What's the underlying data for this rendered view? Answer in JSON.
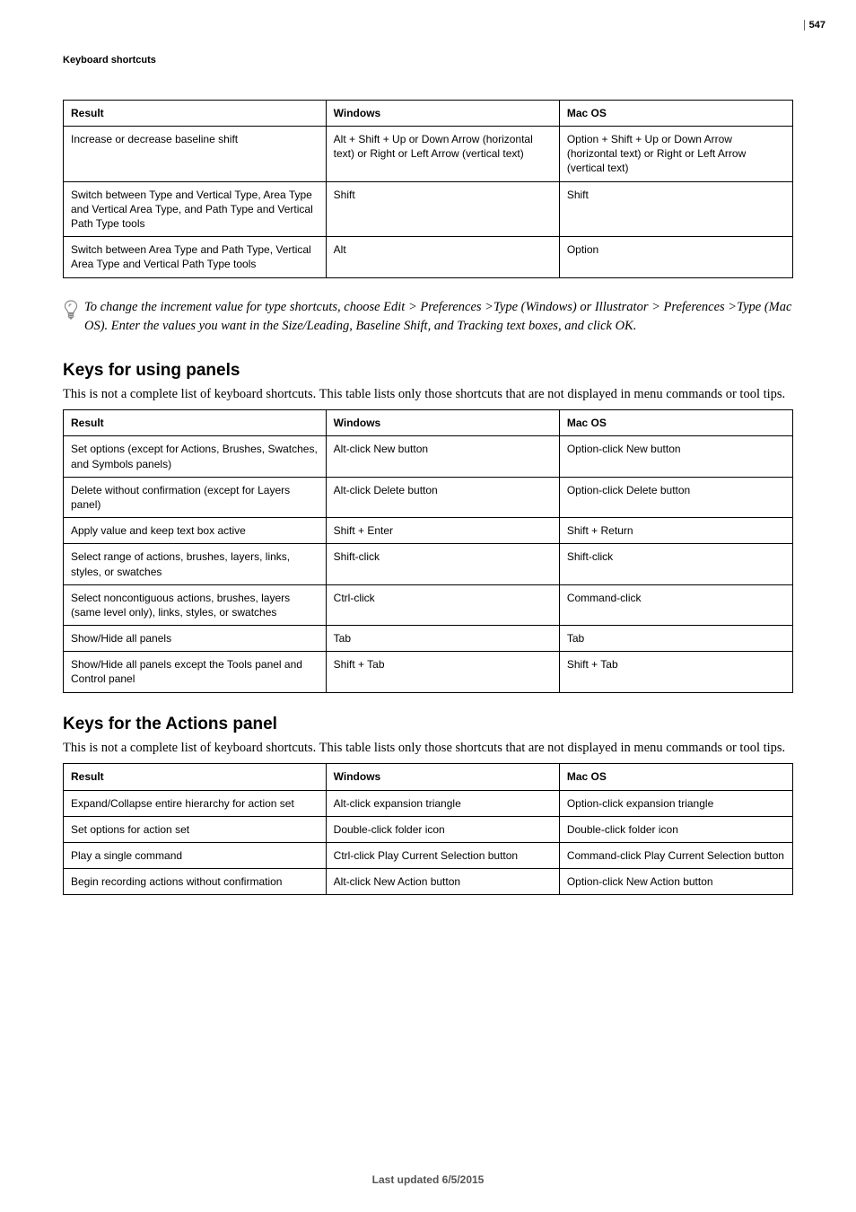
{
  "page_number": "547",
  "running_head": "Keyboard shortcuts",
  "footer": "Last updated 6/5/2015",
  "table_type_cont": {
    "headers": [
      "Result",
      "Windows",
      "Mac OS"
    ],
    "rows": [
      [
        "Increase or decrease baseline shift",
        "Alt + Shift + Up or Down Arrow (horizontal text) or Right or Left Arrow (vertical text)",
        "Option + Shift + Up or Down Arrow (horizontal text) or Right or Left Arrow (vertical text)"
      ],
      [
        "Switch between Type and Vertical Type, Area Type and Vertical Area Type, and Path Type and Vertical Path Type tools",
        "Shift",
        "Shift"
      ],
      [
        "Switch between Area Type and Path Type, Vertical Area Type and Vertical Path Type tools",
        "Alt",
        "Option"
      ]
    ]
  },
  "tip_text": "To change the increment value for type shortcuts, choose Edit > Preferences >Type (Windows) or Illustrator > Preferences >Type (Mac OS). Enter the values you want in the Size/Leading, Baseline Shift, and Tracking text boxes, and click OK.",
  "section_panels": {
    "heading": "Keys for using panels",
    "intro": "This is not a complete list of keyboard shortcuts. This table lists only those shortcuts that are not displayed in menu commands or tool tips.",
    "table": {
      "headers": [
        "Result",
        "Windows",
        "Mac OS"
      ],
      "rows": [
        [
          "Set options (except for Actions, Brushes, Swatches, and Symbols panels)",
          "Alt-click New button",
          "Option-click New button"
        ],
        [
          "Delete without confirmation (except for Layers panel)",
          "Alt-click Delete button",
          "Option-click Delete button"
        ],
        [
          "Apply value and keep text box active",
          "Shift + Enter",
          "Shift + Return"
        ],
        [
          "Select range of actions, brushes, layers, links, styles, or swatches",
          "Shift-click",
          "Shift-click"
        ],
        [
          "Select noncontiguous actions, brushes, layers (same level only), links, styles, or swatches",
          "Ctrl-click",
          "Command-click"
        ],
        [
          "Show/Hide all panels",
          "Tab",
          "Tab"
        ],
        [
          "Show/Hide all panels except the Tools panel and Control panel",
          "Shift + Tab",
          "Shift + Tab"
        ]
      ]
    }
  },
  "section_actions": {
    "heading": "Keys for the Actions panel",
    "intro": "This is not a complete list of keyboard shortcuts. This table lists only those shortcuts that are not displayed in menu commands or tool tips.",
    "table": {
      "headers": [
        "Result",
        "Windows",
        "Mac OS"
      ],
      "rows": [
        [
          "Expand/Collapse entire hierarchy for action set",
          "Alt-click expansion triangle",
          "Option-click expansion triangle"
        ],
        [
          "Set options for action set",
          "Double-click folder icon",
          "Double-click folder icon"
        ],
        [
          "Play a single command",
          "Ctrl-click Play Current Selection button",
          "Command-click Play Current Selection button"
        ],
        [
          "Begin recording actions without confirmation",
          "Alt-click New Action button",
          "Option-click New Action button"
        ]
      ]
    }
  }
}
